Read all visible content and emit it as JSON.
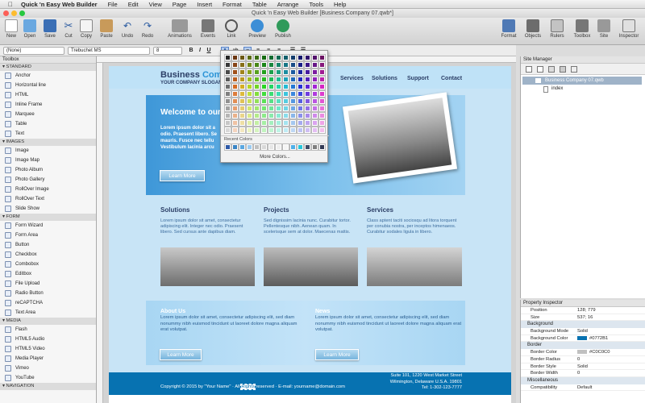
{
  "menubar": {
    "app": "Quick 'n Easy Web Builder",
    "items": [
      "File",
      "Edit",
      "View",
      "Page",
      "Insert",
      "Format",
      "Table",
      "Arrange",
      "Tools",
      "Help"
    ]
  },
  "window_title": "Quick 'n Easy Web Builder [Business Company 07.qwb*]",
  "toolbar_left": [
    "New",
    "Open",
    "Save",
    "Cut",
    "Copy",
    "Paste",
    "Undo",
    "Redo",
    "Animations",
    "Events",
    "Link",
    "Preview",
    "Publish"
  ],
  "toolbar_right": [
    "Format",
    "Objects",
    "Rulers",
    "Toolbox",
    "Site",
    "Inspector"
  ],
  "formatbar": {
    "style_value": "(None)",
    "font_value": "Trebuchet MS",
    "size_value": "8"
  },
  "toolbox": {
    "title": "Toolbox",
    "sections": [
      {
        "name": "STANDARD",
        "items": [
          "Anchor",
          "Horizontal line",
          "HTML",
          "Inline Frame",
          "Marquee",
          "Table",
          "Text"
        ]
      },
      {
        "name": "IMAGES",
        "items": [
          "Image",
          "Image Map",
          "Photo Album",
          "Photo Gallery",
          "RollOver Image",
          "RollOver Text",
          "Slide Show"
        ]
      },
      {
        "name": "FORM",
        "items": [
          "Form Wizard",
          "Form Area",
          "Button",
          "Checkbox",
          "Combobox",
          "Editbox",
          "File Upload",
          "Radio Button",
          "reCAPTCHA",
          "Text Area"
        ]
      },
      {
        "name": "MEDIA",
        "items": [
          "Flash",
          "HTML5 Audio",
          "HTML5 Video",
          "Media Player",
          "Vimeo",
          "YouTube"
        ]
      },
      {
        "name": "NAVIGATION",
        "items": []
      }
    ]
  },
  "palette": {
    "recent_label": "Recent Colors",
    "more_label": "More Colors...",
    "recent": [
      "#2e5aa8",
      "#3a84c4",
      "#5aa7e0",
      "#9ccbf0",
      "#c0c0c0",
      "#d8d8d8",
      "#e6e6e6",
      "#eeeeee",
      "#f5f5f5",
      "#4fb0e8",
      "#26c6da",
      "#3e4a66",
      "#7f7f7f",
      "#333a55"
    ]
  },
  "site": {
    "brand_a": "Business ",
    "brand_b": "Company",
    "slogan": "YOUR COMPANY SLOGAN",
    "nav": [
      "Services",
      "Solutions",
      "Support",
      "Contact"
    ],
    "welcome": "Welcome to our",
    "lorem_short": "Lorem ipsum dolor sit a odio. Praesent libero. Se mauris. Fusce nec tellu Vestibulum lacinia arcu",
    "learn_more": "Learn More",
    "cols": [
      {
        "title": "Solutions",
        "text": "Lorem ipsum dolor sit amet, consectetur adipiscing elit. Integer nec odio. Praesent libero. Sed cursus ante dapibus diam."
      },
      {
        "title": "Projects",
        "text": "Sed dignissim lacinia nunc. Curabitur tortor. Pellentesque nibh. Aenean quam. In scelerisque sem at dolor. Maecenas mattis."
      },
      {
        "title": "Services",
        "text": "Class aptent taciti sociosqu ad litora torquent per conubia nostra, per inceptos himenaeos. Curabitur sodales ligula in libero."
      }
    ],
    "about_title": "About Us",
    "about_text": "Lorem ipsum dolor sit amet, consectetur adipiscing elit, sed diam nonummy nibh euismod tincidunt ut laoreet dolore magna aliquam erat volutpat.",
    "news_title": "News",
    "news_text": "Lorem ipsum dolor sit amet, consectetur adipiscing elit, sed diam nonummy nibh euismod tincidunt ut laoreet dolore magna aliquam erat volutpat.",
    "footer_left_a": "Copyright © 2015 by \"Your Name\"  ·  All ",
    "footer_left_sel": "Rights",
    "footer_left_b": " reserved  ·  E-mail: yourname@domain.com",
    "footer_right_1": "Suite 101, 1220 West Market Street",
    "footer_right_2": "Wilmington, Delaware  U.S.A. 19801",
    "footer_right_3": "Tel: 1-302-123-7777"
  },
  "site_manager": {
    "title": "Site Manager",
    "root": "Business Company 07.qwb",
    "child": "index"
  },
  "inspector": {
    "title": "Property Inspector",
    "rows_top": [
      [
        "Position",
        "128; 779"
      ],
      [
        "Size",
        "537; 16"
      ]
    ],
    "sections": [
      {
        "name": "Background",
        "rows": [
          [
            "Background Mode",
            "Solid"
          ],
          [
            "Background Color",
            "#0772B1"
          ]
        ]
      },
      {
        "name": "Border",
        "rows": [
          [
            "Border Color",
            "#C0C0C0"
          ],
          [
            "Border Radius",
            "0"
          ],
          [
            "Border Style",
            "Solid"
          ],
          [
            "Border Width",
            "0"
          ]
        ]
      },
      {
        "name": "Miscellaneous",
        "rows": [
          [
            "Compatibility",
            "Default"
          ]
        ]
      }
    ]
  },
  "colors": {
    "accent": "#0772B1",
    "light_blue": "#bfe2f7",
    "mid_blue": "#3d9bd8"
  }
}
